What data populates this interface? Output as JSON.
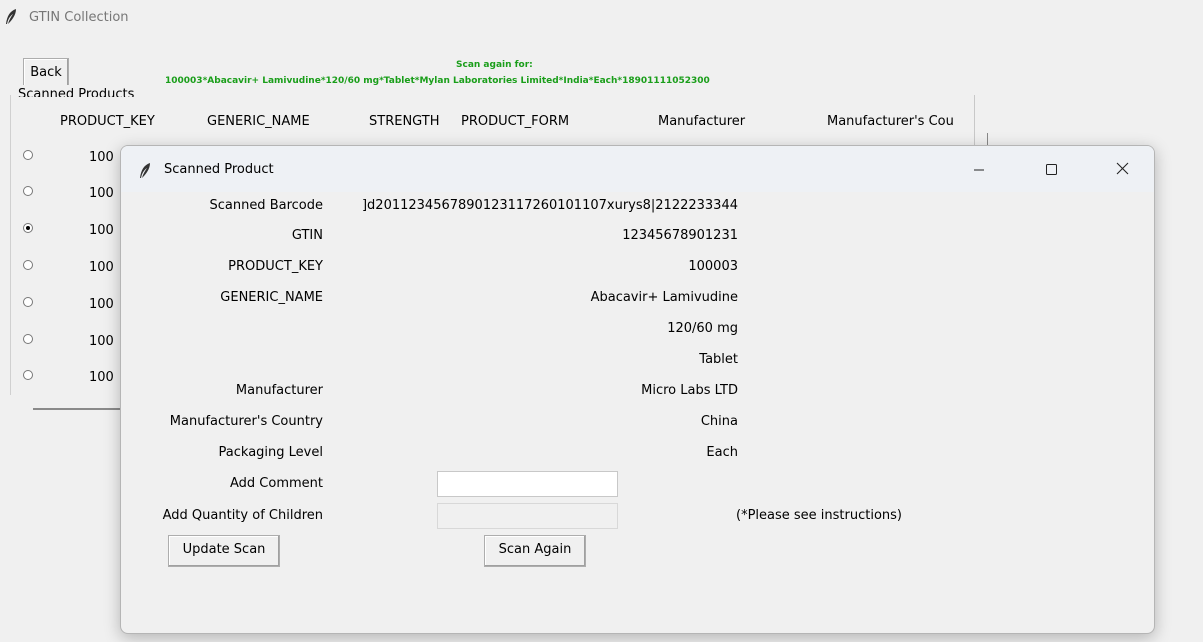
{
  "app": {
    "title": "GTIN Collection"
  },
  "toolbar": {
    "back_label": "Back"
  },
  "scan_again": {
    "title": "Scan again for:",
    "detail": "100003*Abacavir+ Lamivudine*120/60 mg*Tablet*Mylan Laboratories Limited*India*Each*18901111052300"
  },
  "products": {
    "frame_label": "Scanned Products",
    "columns": [
      "PRODUCT_KEY",
      "GENERIC_NAME",
      "STRENGTH",
      "PRODUCT_FORM",
      "Manufacturer",
      "Manufacturer's Cou"
    ],
    "rows": [
      {
        "key": "100",
        "selected": false
      },
      {
        "key": "100",
        "selected": false
      },
      {
        "key": "100",
        "selected": true
      },
      {
        "key": "100",
        "selected": false
      },
      {
        "key": "100",
        "selected": false
      },
      {
        "key": "100",
        "selected": false
      },
      {
        "key": "100",
        "selected": false
      }
    ]
  },
  "dialog": {
    "title": "Scanned Product",
    "fields": [
      {
        "label": "Scanned Barcode",
        "value": "]d2011234567890123117260101107xurys8|2122233344"
      },
      {
        "label": "GTIN",
        "value": "12345678901231"
      },
      {
        "label": "PRODUCT_KEY",
        "value": "100003"
      },
      {
        "label": "GENERIC_NAME",
        "value": "Abacavir+ Lamivudine"
      },
      {
        "label": "",
        "value": "120/60 mg"
      },
      {
        "label": "",
        "value": "Tablet"
      },
      {
        "label": "Manufacturer",
        "value": "Micro Labs LTD"
      },
      {
        "label": "Manufacturer's Country",
        "value": "China"
      },
      {
        "label": "Packaging Level",
        "value": "Each"
      }
    ],
    "add_comment_label": "Add Comment",
    "add_comment_value": "",
    "add_children_label": "Add Quantity of Children",
    "add_children_value": "",
    "instructions_note": "(*Please see instructions)",
    "update_label": "Update Scan",
    "scan_again_label": "Scan Again"
  }
}
